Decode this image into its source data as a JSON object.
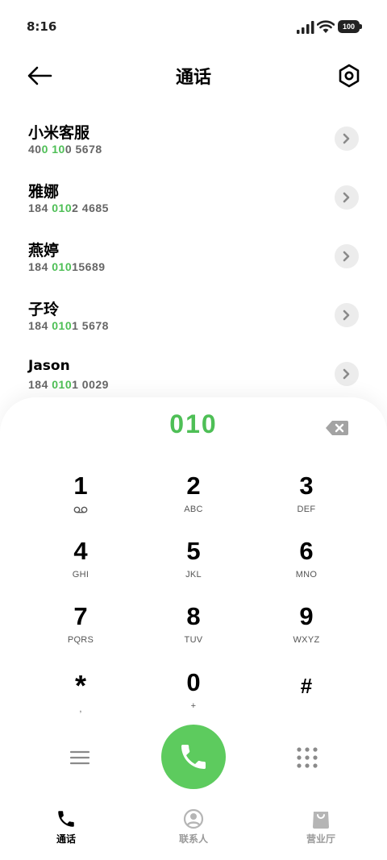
{
  "status_bar": {
    "time": "8:16",
    "battery": "100"
  },
  "header": {
    "title": "通话"
  },
  "contacts": [
    {
      "name": "小米客服",
      "number_pre": "40",
      "number_hl": "0 10",
      "number_post": "0 5678"
    },
    {
      "name": "雅娜",
      "number_pre": "184 ",
      "number_hl": "010",
      "number_post": "2 4685"
    },
    {
      "name": "燕婷",
      "number_pre": "184 ",
      "number_hl": "010",
      "number_post": "15689"
    },
    {
      "name": "子玲",
      "number_pre": "184 ",
      "number_hl": "010",
      "number_post": "1 5678"
    },
    {
      "name": "Jason",
      "number_pre": "184 ",
      "number_hl": "010",
      "number_post": "1 0029"
    }
  ],
  "dialer": {
    "number": "010",
    "keys": [
      {
        "digit": "1",
        "letters": ""
      },
      {
        "digit": "2",
        "letters": "ABC"
      },
      {
        "digit": "3",
        "letters": "DEF"
      },
      {
        "digit": "4",
        "letters": "GHI"
      },
      {
        "digit": "5",
        "letters": "JKL"
      },
      {
        "digit": "6",
        "letters": "MNO"
      },
      {
        "digit": "7",
        "letters": "PQRS"
      },
      {
        "digit": "8",
        "letters": "TUV"
      },
      {
        "digit": "9",
        "letters": "WXYZ"
      },
      {
        "digit": "*",
        "letters": ","
      },
      {
        "digit": "0",
        "letters": "+"
      },
      {
        "digit": "#",
        "letters": ""
      }
    ]
  },
  "bottom_nav": [
    {
      "label": "通话",
      "icon": "phone-icon",
      "active": true
    },
    {
      "label": "联系人",
      "icon": "person-icon",
      "active": false
    },
    {
      "label": "营业厅",
      "icon": "bag-icon",
      "active": false
    }
  ],
  "colors": {
    "accent": "#4ebf56",
    "call_button": "#5dcb5e",
    "arrow_bg": "#ececec"
  }
}
